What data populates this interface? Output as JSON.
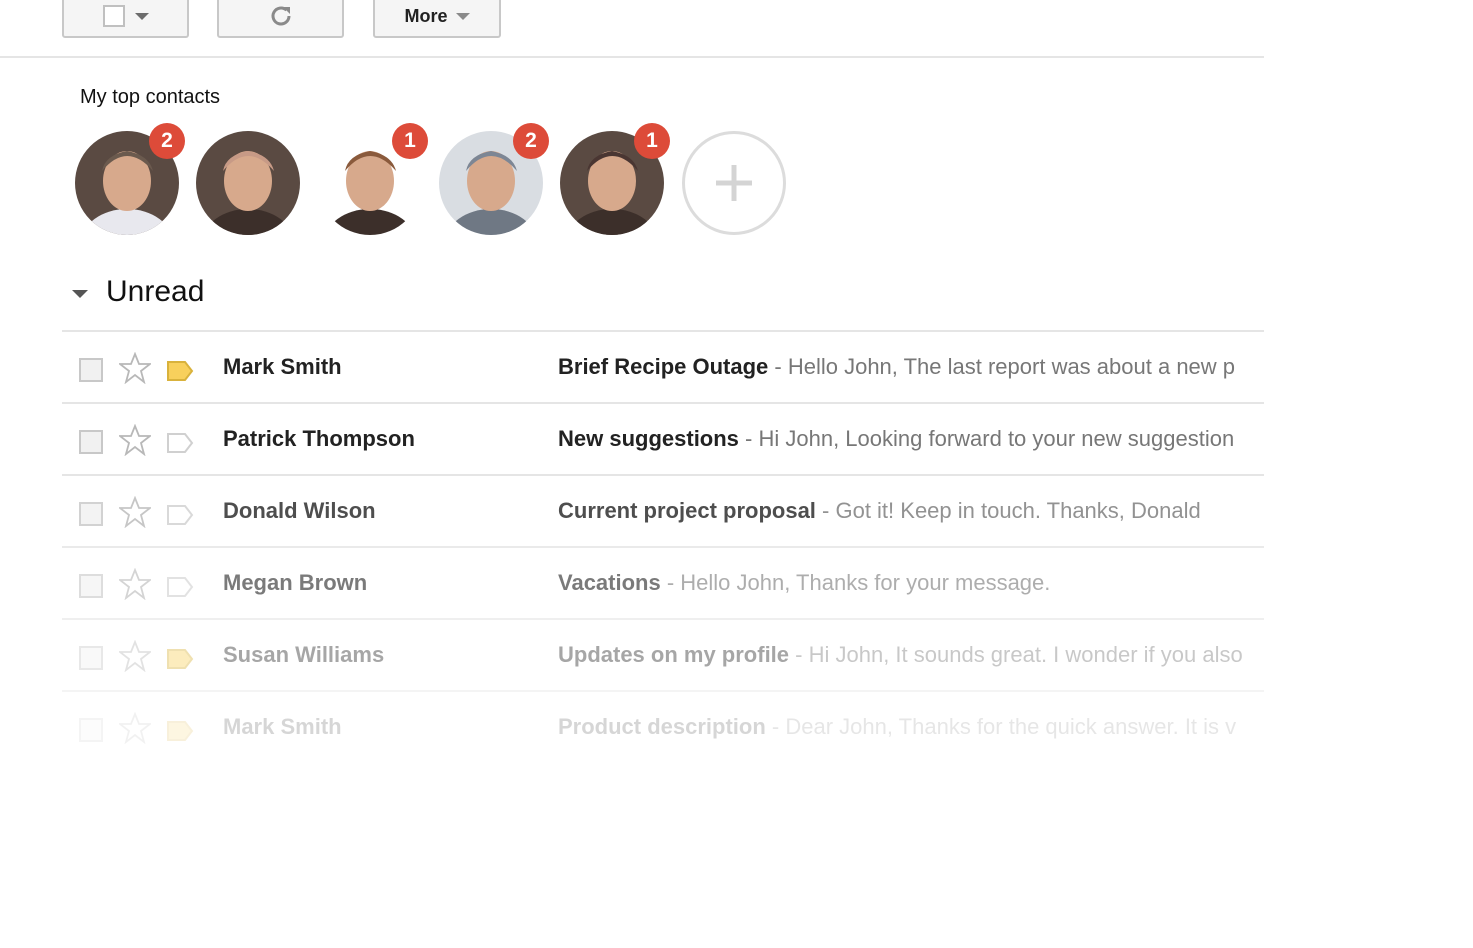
{
  "toolbar": {
    "select_icon": "checkbox-dropdown-icon",
    "refresh_icon": "refresh-icon",
    "more_label": "More"
  },
  "contacts": {
    "title": "My top contacts",
    "items": [
      {
        "badge": "2",
        "color": "#6b5a4e"
      },
      {
        "badge": "",
        "color": "#c79a86"
      },
      {
        "badge": "1",
        "color": "#8a5a3c"
      },
      {
        "badge": "2",
        "color": "#7d8694"
      },
      {
        "badge": "1",
        "color": "#4a3632"
      }
    ],
    "add_icon": "plus-icon"
  },
  "unread": {
    "title": "Unread",
    "rows": [
      {
        "sender": "Mark Smith",
        "subject": "Brief Recipe Outage",
        "snippet": " - Hello John, The last report was about a new p",
        "labelled": true
      },
      {
        "sender": "Patrick Thompson",
        "subject": "New suggestions",
        "snippet": " - Hi John, Looking forward to your new suggestion",
        "labelled": false
      },
      {
        "sender": "Donald Wilson",
        "subject": "Current project proposal",
        "snippet": " - Got it! Keep in touch. Thanks, Donald",
        "labelled": false
      },
      {
        "sender": "Megan Brown",
        "subject": "Vacations",
        "snippet": " - Hello John, Thanks for your message.",
        "labelled": false
      },
      {
        "sender": "Susan Williams",
        "subject": "Updates on my profile",
        "snippet": " - Hi John, It sounds great. I wonder if you also",
        "labelled": true
      },
      {
        "sender": "Mark Smith",
        "subject": "Product description",
        "snippet": " - Dear John, Thanks for the quick answer. It is v",
        "labelled": true
      }
    ]
  },
  "colors": {
    "badge": "#dd4b39",
    "label_important": "#f8d05c"
  }
}
